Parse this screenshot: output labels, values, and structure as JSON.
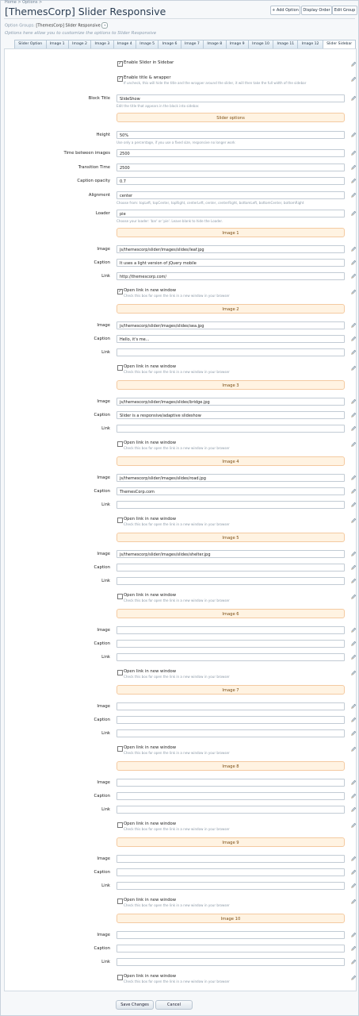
{
  "breadcrumb": "Home > Options >",
  "page": {
    "title": "[ThemesCorp] Slider Responsive",
    "buttons": [
      "+ Add Option",
      "Display Order",
      "Edit Group"
    ],
    "option_groups_label": "Option Groups:",
    "option_groups_value": "[ThemesCorp] Slider Responsive",
    "description": "Options here allow you to customize the options to Slider Responsive"
  },
  "tabs": [
    "Slider Option",
    "Image 1",
    "Image 2",
    "Image 3",
    "Image 4",
    "Image 5",
    "Image 6",
    "Image 7",
    "Image 8",
    "Image 9",
    "Image 10",
    "Image 11",
    "Image 12",
    "Slider Sidebar"
  ],
  "active_tab": "Slider Sidebar",
  "top": {
    "enable_slider_label": "Enable Slider in Sidebar",
    "enable_slider_checked": true,
    "enable_title_label": "Enable title & wrapper",
    "enable_title_checked": true,
    "enable_title_hint": "If uncheck, this will hide the title and the wrapper around the slider, it will then take the full width of the sidebar",
    "block_title_label": "Block Title",
    "block_title_value": "SlideShow",
    "block_title_hint": "Edit the title that appears in the block into sidebar."
  },
  "slider_options": {
    "header": "Slider options",
    "height_label": "Height",
    "height_value": "50%",
    "height_hint": "Use only a percentage, if you use a fixed size, responsive no longer work",
    "time_label": "Time between images",
    "time_value": "2500",
    "transition_label": "Transition Time",
    "transition_value": "2500",
    "caption_opacity_label": "Caption opacity",
    "caption_opacity_value": "0.7",
    "alignment_label": "Alignment",
    "alignment_value": "center",
    "alignment_hint": "Choose from: topLeft, topCenter, topRight, centerLeft, center, centerRight, bottomLeft, bottomCenter, bottomRight",
    "loader_label": "Loader",
    "loader_value": "pie",
    "loader_hint": "Choose your loader: 'bar' or 'pie'. Leave blank to hide the Loader."
  },
  "image_labels": {
    "image": "Image",
    "caption": "Caption",
    "link": "Link",
    "open": "Open link in new window",
    "open_hint": "Check this box for open the link in a new window in your browser"
  },
  "images": [
    {
      "header": "Image 1",
      "image": "js/themescorp/slider/images/slides/leaf.jpg",
      "caption": "It uses a light version of jQuery mobile",
      "link": "http://themescorp.com/",
      "open": true
    },
    {
      "header": "Image 2",
      "image": "js/themescorp/slider/images/slides/sea.jpg",
      "caption": "Hello, it's me...",
      "link": "",
      "open": false
    },
    {
      "header": "Image 3",
      "image": "js/themescorp/slider/images/slides/bridge.jpg",
      "caption": "Slider is a responsive/adaptive slideshow",
      "link": "",
      "open": false
    },
    {
      "header": "Image 4",
      "image": "js/themescorp/slider/images/slides/road.jpg",
      "caption": "ThemesCorp.com",
      "link": "",
      "open": false
    },
    {
      "header": "Image 5",
      "image": "js/themescorp/slider/images/slides/shelter.jpg",
      "caption": "",
      "link": "",
      "open": false
    },
    {
      "header": "Image 6",
      "image": "",
      "caption": "",
      "link": "",
      "open": false
    },
    {
      "header": "Image 7",
      "image": "",
      "caption": "",
      "link": "",
      "open": false
    },
    {
      "header": "Image 8",
      "image": "",
      "caption": "",
      "link": "",
      "open": false
    },
    {
      "header": "Image 9",
      "image": "",
      "caption": "",
      "link": "",
      "open": false
    },
    {
      "header": "Image 10",
      "image": "",
      "caption": "",
      "link": "",
      "open": false
    }
  ],
  "footer": {
    "save": "Save Changes",
    "cancel": "Cancel"
  },
  "icons": {
    "edit": "pencil-icon",
    "dropdown": "chevron-down-icon"
  },
  "colors": {
    "section_bg": "#fff3e2",
    "section_border": "#f4caa1",
    "section_text": "#7b4d13",
    "title": "#2a3d52"
  }
}
